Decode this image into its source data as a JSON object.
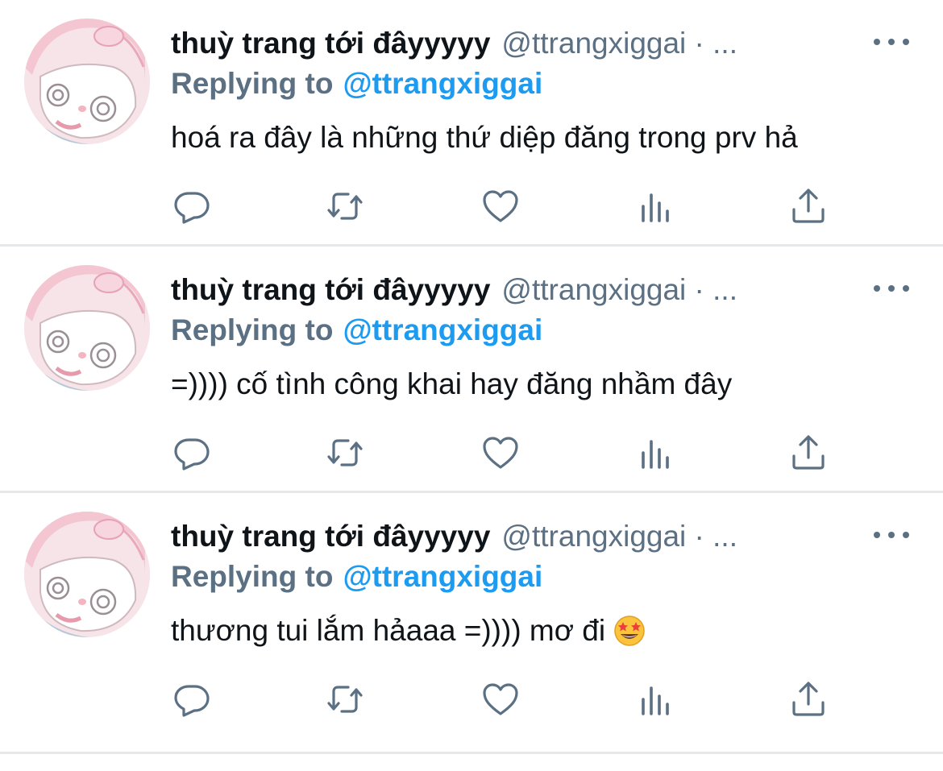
{
  "colors": {
    "name_text": "#0f1419",
    "secondary_text": "#5b7083",
    "link_blue": "#1d9bf0",
    "divider": "#e6e9ec",
    "avatar_bg": "#f7e4e8"
  },
  "tweets": [
    {
      "display_name": "thuỳ trang tới đâyyyyy",
      "handle": "@ttrangxiggai · ...",
      "replying_label": "Replying to",
      "replying_handle": "@ttrangxiggai",
      "text": "hoá ra đây là những thứ diệp đăng trong prv hả",
      "icons": [
        "reply-icon",
        "retweet-icon",
        "like-icon",
        "analytics-icon",
        "share-icon",
        "more-icon"
      ]
    },
    {
      "display_name": "thuỳ trang tới đâyyyyy",
      "handle": "@ttrangxiggai · ...",
      "replying_label": "Replying to",
      "replying_handle": "@ttrangxiggai",
      "text": "=)))) cố tình công khai hay đăng nhầm đây",
      "icons": [
        "reply-icon",
        "retweet-icon",
        "like-icon",
        "analytics-icon",
        "share-icon",
        "more-icon"
      ]
    },
    {
      "display_name": "thuỳ trang tới đâyyyyy",
      "handle": "@ttrangxiggai · ...",
      "replying_label": "Replying to",
      "replying_handle": "@ttrangxiggai",
      "text": "thương tui lắm hảaaa =)))) mơ đi",
      "emoji": "star-struck-emoji",
      "icons": [
        "reply-icon",
        "retweet-icon",
        "like-icon",
        "analytics-icon",
        "share-icon",
        "more-icon"
      ]
    }
  ]
}
